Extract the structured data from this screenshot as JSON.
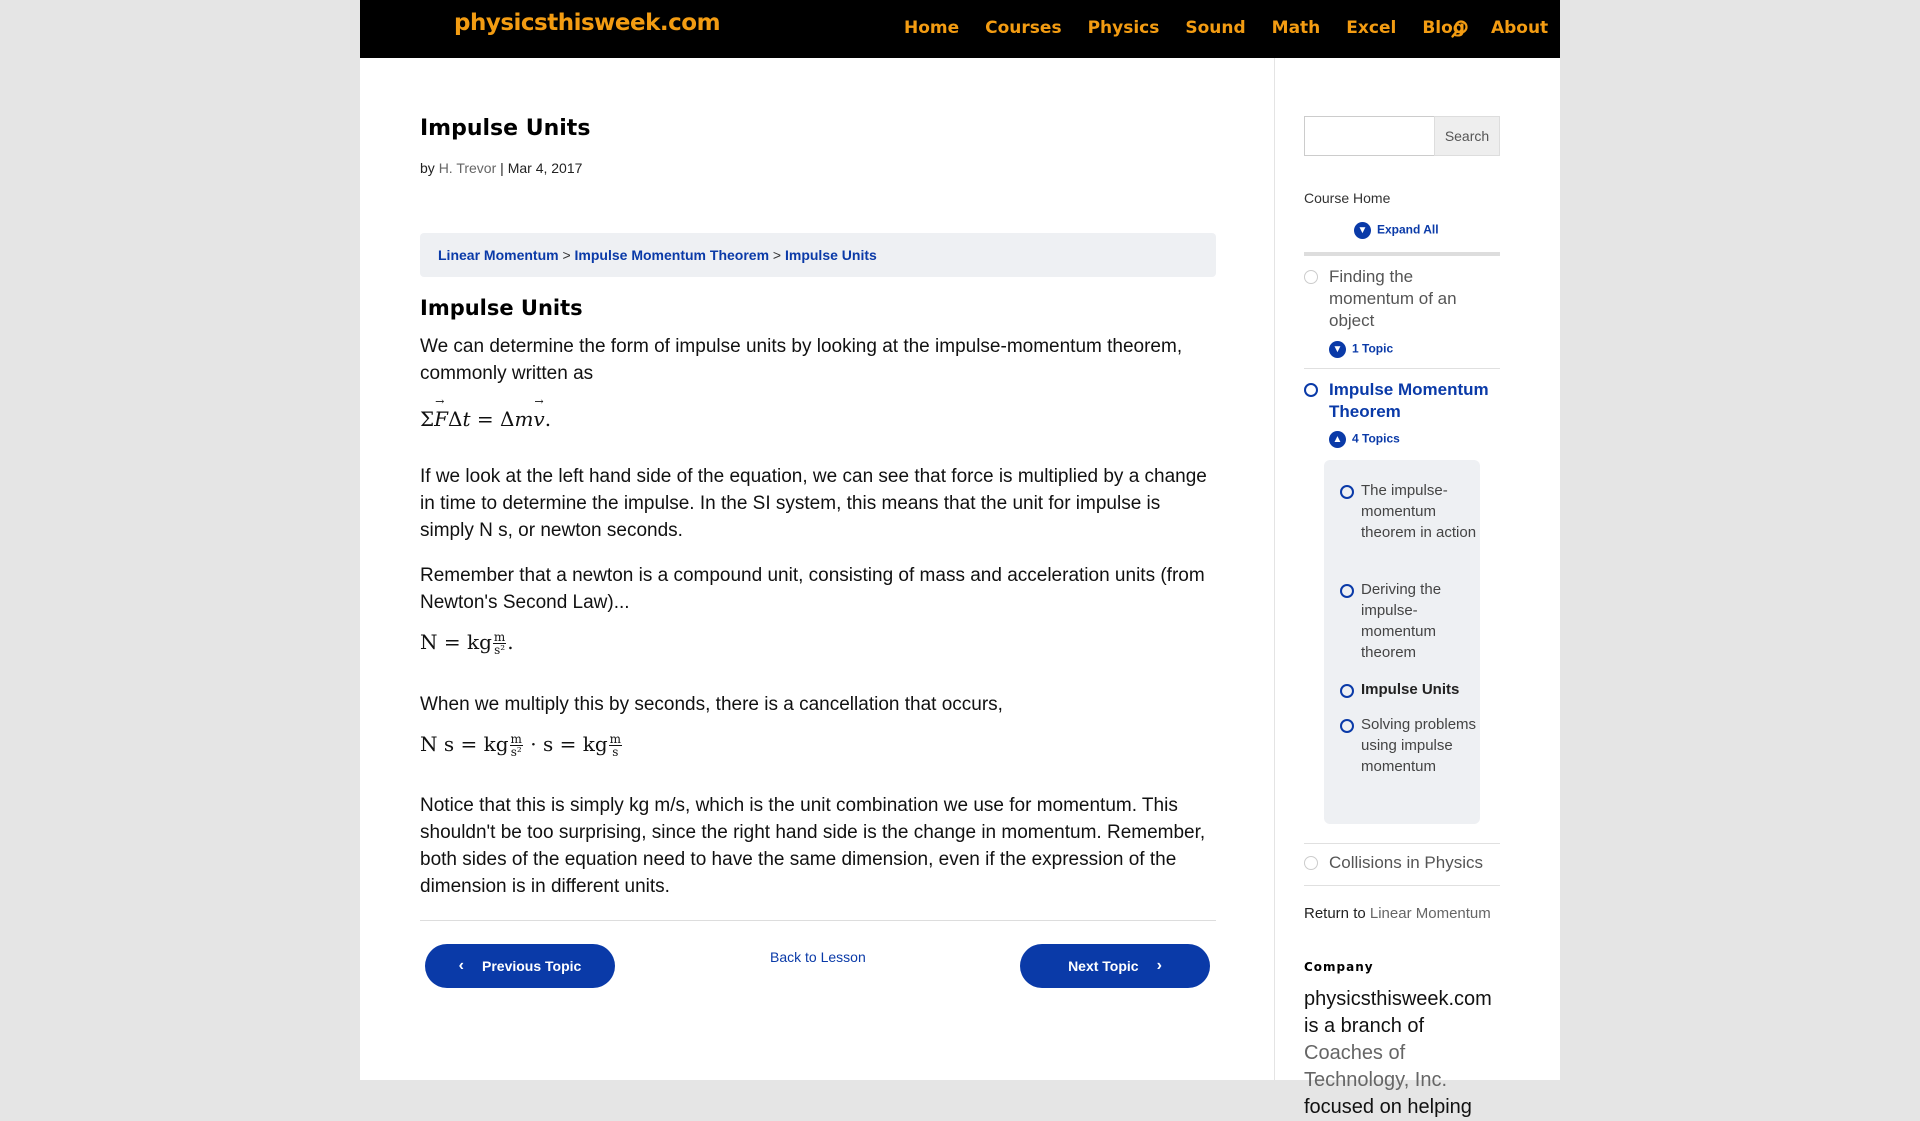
{
  "header": {
    "logo": "physicsthisweek.com",
    "nav": [
      "Home",
      "Courses",
      "Physics",
      "Sound",
      "Math",
      "Excel",
      "Blog",
      "About"
    ]
  },
  "post": {
    "title": "Impulse Units",
    "meta_by": "by",
    "author": "H. Trevor",
    "meta_sep": "|",
    "date": "Mar 4, 2017"
  },
  "breadcrumb": {
    "items": [
      "Linear Momentum",
      "Impulse Momentum Theorem",
      "Impulse Units"
    ],
    "separator": ">"
  },
  "content": {
    "heading": "Impulse Units",
    "p1": "We can determine the form of impulse units by looking at the impulse-momentum theorem, commonly written as",
    "p2": "If we look at the left hand side of the equation, we can see that force is multiplied by a change in time to determine the impulse.  In the SI system, this means that the unit for impulse is simply N s, or newton seconds.",
    "p3": "Remember that a newton is a compound unit, consisting of mass and acceleration units (from Newton's Second Law)...",
    "p4": "When we multiply this by seconds, there is a cancellation that occurs,",
    "p5": "Notice that this is simply kg m/s, which is the unit combination we use for momentum.  This shouldn't be too surprising, since the right hand side is the change in momentum.  Remember, both sides of the equation need to have the same dimension, even if the expression of the dimension is in different units."
  },
  "navigation": {
    "prev": "Previous Topic",
    "back": "Back to Lesson",
    "next": "Next Topic"
  },
  "sidebar": {
    "search_button": "Search",
    "search_placeholder": "",
    "course_home": "Course Home",
    "expand_all": "Expand All",
    "lessons": [
      {
        "title": "Finding the momentum of an object",
        "topics_label": "1 Topic"
      },
      {
        "title": "Impulse Momentum Theorem",
        "topics_label": "4 Topics"
      },
      {
        "title": "Collisions in Physics"
      }
    ],
    "topics": [
      "The impulse-momentum theorem in action",
      "Deriving the impulse-momentum theorem",
      "Impulse Units",
      "Solving problems using impulse momentum"
    ],
    "return_label": "Return to",
    "return_link": "Linear Momentum",
    "company_heading": "Company",
    "about_text_1": "physicsthisweek.com is a branch of",
    "about_link": "Coaches of Technology, Inc.",
    "about_text_2": "focused on helping"
  },
  "colors": {
    "accent": "#0a3aa8",
    "logo_orange": "#f39c12",
    "header_bg": "#000000"
  }
}
